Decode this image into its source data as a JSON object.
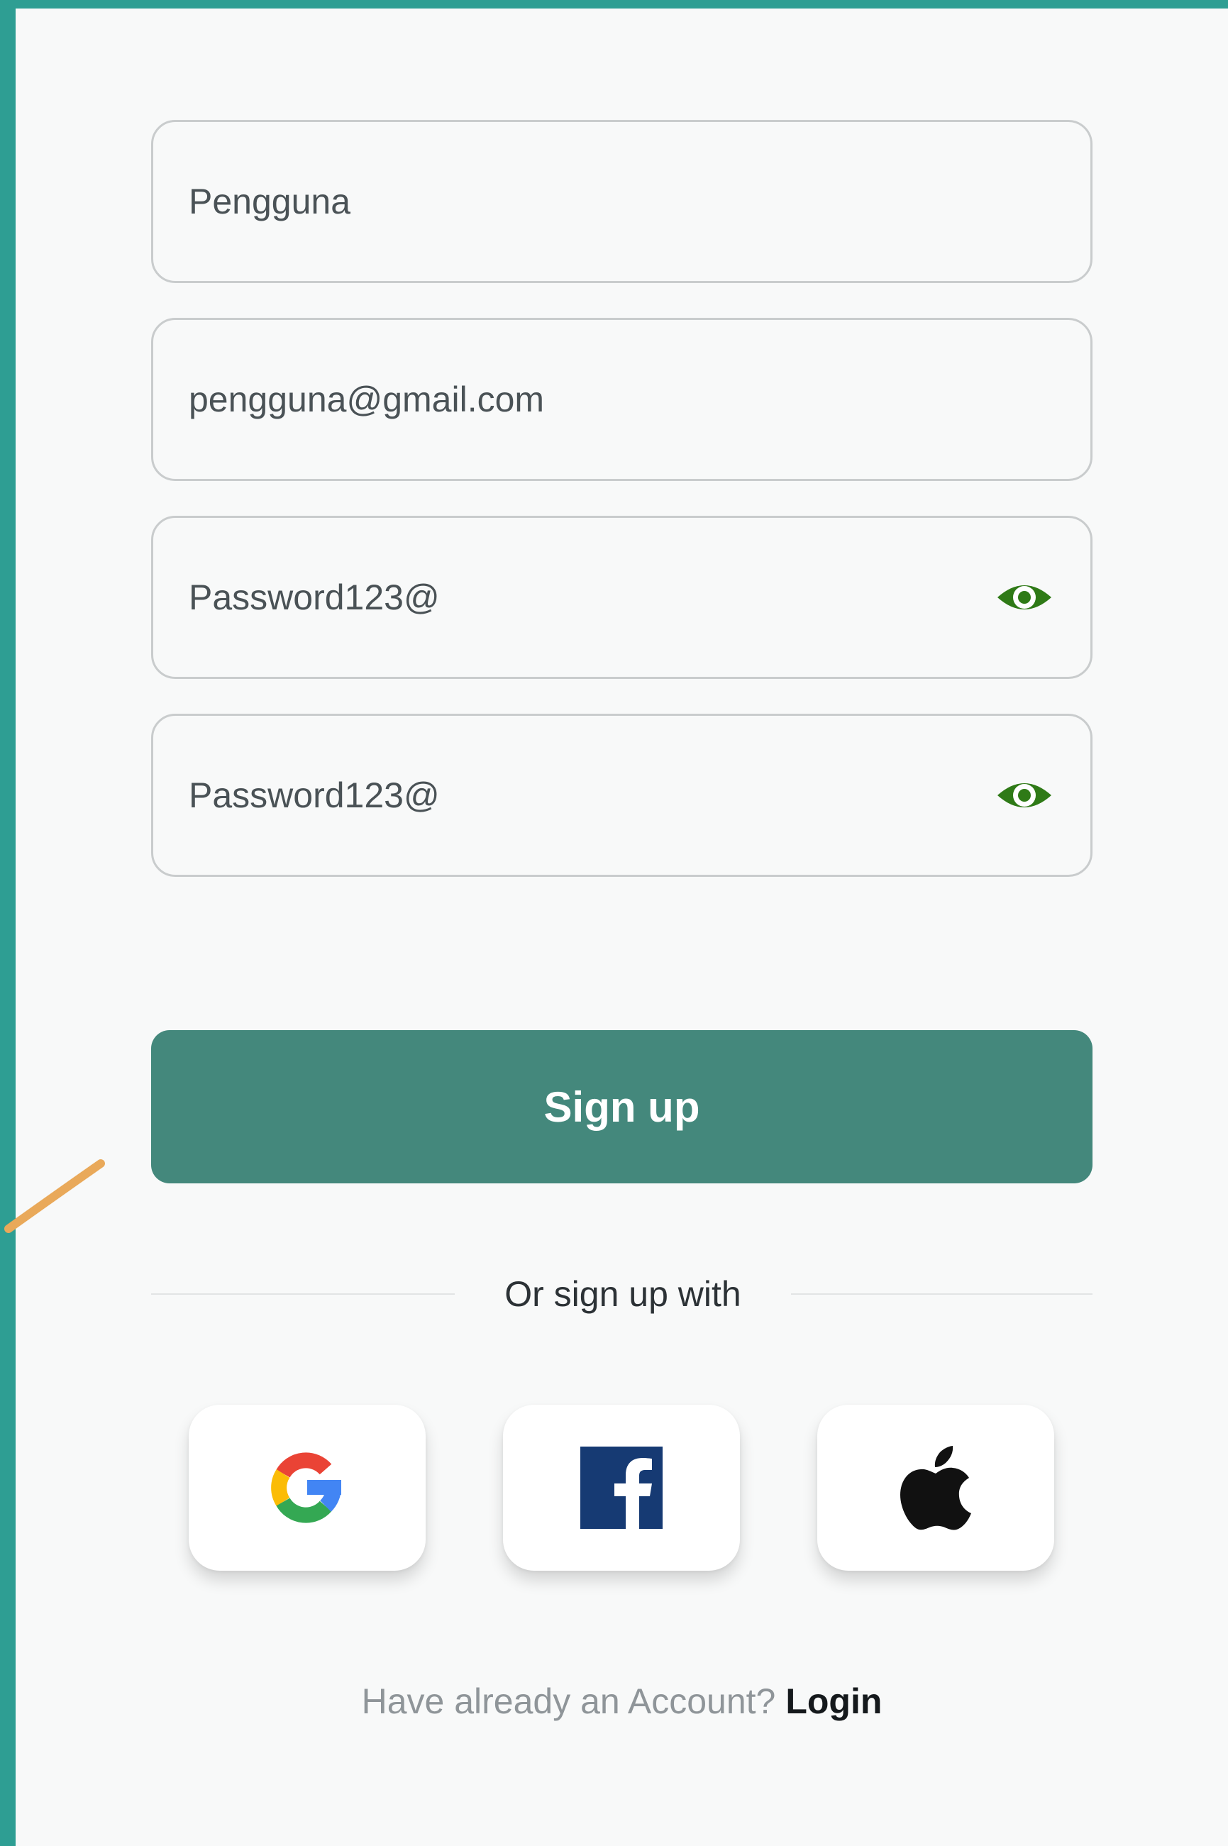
{
  "form": {
    "username": {
      "value": "Pengguna"
    },
    "email": {
      "value": "pengguna@gmail.com"
    },
    "password": {
      "value": "Password123@"
    },
    "confirm_password": {
      "value": "Password123@"
    }
  },
  "signup_button": {
    "label": "Sign up"
  },
  "divider": {
    "label": "Or sign up with"
  },
  "social": [
    {
      "provider": "google",
      "icon": "google-logo-icon"
    },
    {
      "provider": "facebook",
      "icon": "facebook-logo-icon"
    },
    {
      "provider": "apple",
      "icon": "apple-logo-icon"
    }
  ],
  "footer": {
    "prompt": "Have already an Account?",
    "login_label": "Login"
  },
  "colors": {
    "frame_teal": "#2e9e93",
    "primary_button": "#44887c",
    "eye_icon_green": "#2f7a17",
    "accent_stroke": "#e9a95a",
    "facebook_blue": "#163a73"
  }
}
